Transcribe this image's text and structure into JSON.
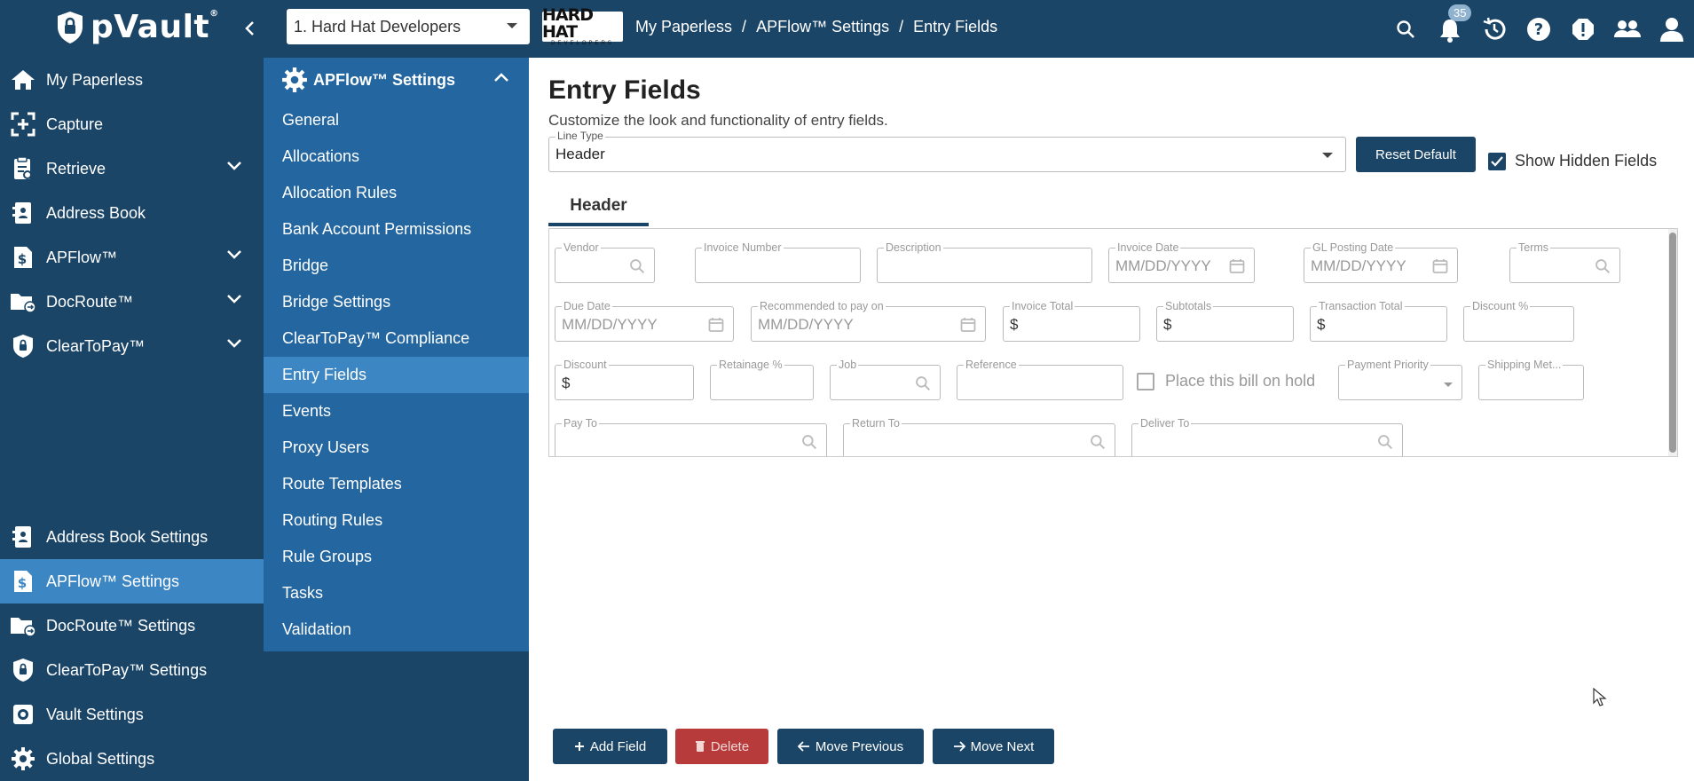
{
  "app": {
    "name": "pVault",
    "trademark": "®"
  },
  "company": {
    "selected": "1. Hard Hat Developers",
    "logo_line1": "HARD HAT",
    "logo_line2": "DEVELOPERS"
  },
  "breadcrumb": [
    "My Paperless",
    "/",
    "APFlow™ Settings",
    "/",
    "Entry Fields"
  ],
  "notifications": {
    "count": "35"
  },
  "sidebar": {
    "items": [
      {
        "label": "My Paperless",
        "icon": "home-icon"
      },
      {
        "label": "Capture",
        "icon": "capture-icon"
      },
      {
        "label": "Retrieve",
        "icon": "retrieve-icon"
      },
      {
        "label": "Address Book",
        "icon": "address-book-icon"
      },
      {
        "label": "APFlow™",
        "icon": "apflow-icon"
      },
      {
        "label": "DocRoute™",
        "icon": "docroute-icon"
      },
      {
        "label": "ClearToPay™",
        "icon": "cleartopay-icon"
      },
      {
        "label": "Address Book Settings",
        "icon": "address-book-icon"
      },
      {
        "label": "APFlow™ Settings",
        "icon": "apflow-icon"
      },
      {
        "label": "DocRoute™ Settings",
        "icon": "docroute-icon"
      },
      {
        "label": "ClearToPay™ Settings",
        "icon": "cleartopay-icon"
      },
      {
        "label": "Vault Settings",
        "icon": "gear-icon"
      },
      {
        "label": "Global Settings",
        "icon": "gear-icon"
      }
    ]
  },
  "submenu": {
    "title": "APFlow™ Settings",
    "items": [
      "General",
      "Allocations",
      "Allocation Rules",
      "Bank Account Permissions",
      "Bridge",
      "Bridge Settings",
      "ClearToPay™ Compliance",
      "Entry Fields",
      "Events",
      "Proxy Users",
      "Route Templates",
      "Routing Rules",
      "Rule Groups",
      "Tasks",
      "Validation"
    ],
    "active": "Entry Fields"
  },
  "main": {
    "title": "Entry Fields",
    "subtitle": "Customize the look and functionality of entry fields.",
    "line_type_label": "Line Type",
    "line_type_value": "Header",
    "reset_label": "Reset Default",
    "show_hidden_label": "Show Hidden Fields",
    "tab_label": "Header",
    "fields": {
      "vendor": "Vendor",
      "invoice_number": "Invoice Number",
      "description": "Description",
      "invoice_date": "Invoice Date",
      "gl_posting_date": "GL Posting Date",
      "terms": "Terms",
      "due_date": "Due Date",
      "recommended": "Recommended to pay on",
      "invoice_total": "Invoice Total",
      "subtotals": "Subtotals",
      "transaction_total": "Transaction Total",
      "discount_pct": "Discount %",
      "discount": "Discount",
      "retainage_pct": "Retainage %",
      "job": "Job",
      "reference": "Reference",
      "hold": "Place this bill on hold",
      "payment_priority": "Payment Priority",
      "shipping": "Shipping Met...",
      "pay_to": "Pay To",
      "return_to": "Return To",
      "deliver_to": "Deliver To",
      "date_placeholder": "MM/DD/YYYY",
      "currency": "$"
    },
    "buttons": {
      "add": "Add Field",
      "delete": "Delete",
      "prev": "Move Previous",
      "next": "Move Next"
    }
  }
}
